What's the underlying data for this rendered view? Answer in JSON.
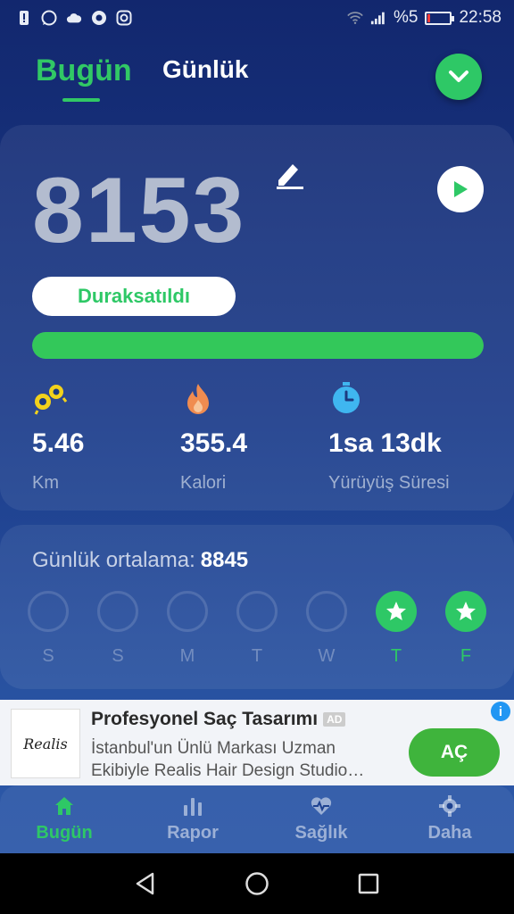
{
  "status_bar": {
    "battery_percent": "%5",
    "time": "22:58"
  },
  "header": {
    "tab_today": "Bugün",
    "tab_daily": "Günlük"
  },
  "steps": {
    "count": "8153",
    "status": "Duraksatıldı",
    "progress_fraction": 1.0,
    "accent_color": "#2ec866"
  },
  "stats": [
    {
      "icon": "distance-icon",
      "value": "5.46",
      "label": "Km"
    },
    {
      "icon": "flame-icon",
      "value": "355.4",
      "label": "Kalori"
    },
    {
      "icon": "stopwatch-icon",
      "value": "1sa 13dk",
      "label": "Yürüyüş Süresi"
    }
  ],
  "weekly": {
    "avg_label": "Günlük ortalama:",
    "avg_value": "8845",
    "days": [
      {
        "label": "S",
        "done": false
      },
      {
        "label": "S",
        "done": false
      },
      {
        "label": "M",
        "done": false
      },
      {
        "label": "T",
        "done": false
      },
      {
        "label": "W",
        "done": false
      },
      {
        "label": "T",
        "done": true
      },
      {
        "label": "F",
        "done": true
      }
    ]
  },
  "ad": {
    "logo_text": "Realis",
    "title": "Profesyonel Saç Tasarımı",
    "badge": "AD",
    "body_line1": "İstanbul'un Ünlü Markası Uzman",
    "body_line2": "Ekibiyle Realis Hair Design Studio…",
    "cta": "AÇ",
    "info": "i"
  },
  "bottom_nav": {
    "items": [
      {
        "label": "Bugün",
        "icon": "home-icon",
        "active": true
      },
      {
        "label": "Rapor",
        "icon": "bar-chart-icon",
        "active": false
      },
      {
        "label": "Sağlık",
        "icon": "heart-pulse-icon",
        "active": false
      },
      {
        "label": "Daha",
        "icon": "settings-icon",
        "active": false
      }
    ]
  }
}
